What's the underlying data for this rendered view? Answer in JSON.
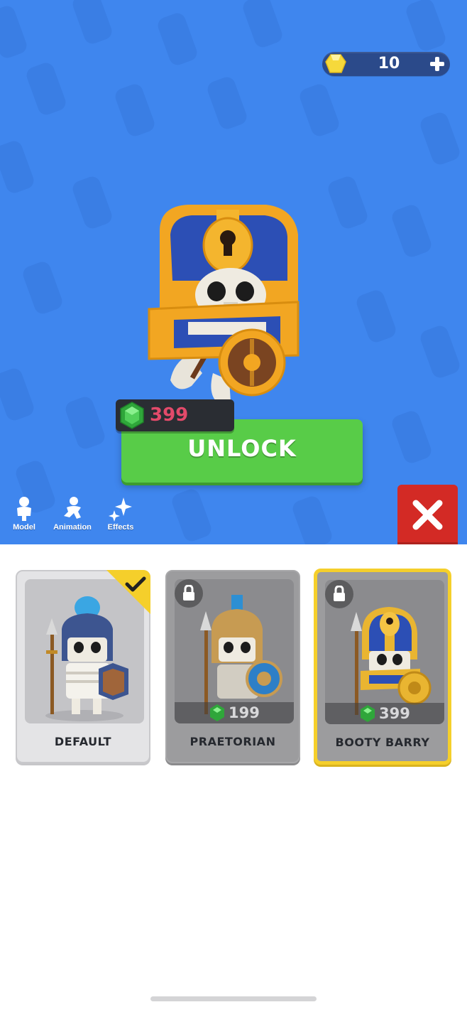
{
  "currency": {
    "amount": "10",
    "add_label": "+"
  },
  "hero": {
    "price": "399",
    "unlock_label": "UNLOCK"
  },
  "modes": [
    {
      "label": "Model"
    },
    {
      "label": "Animation"
    },
    {
      "label": "Effects"
    }
  ],
  "skins": [
    {
      "name": "DEFAULT",
      "owned": true
    },
    {
      "name": "PRAETORIAN",
      "price": "199",
      "locked": true
    },
    {
      "name": "BOOTY BARRY",
      "price": "399",
      "locked": true,
      "selected": true
    }
  ],
  "colors": {
    "background": "#3f86ee",
    "unlock_button": "#58cc48",
    "close_button": "#d32a25",
    "selected_border": "#f5cf2b",
    "price_text": "#e34a6a"
  },
  "icons": [
    "gold-gem-icon",
    "plus-icon",
    "green-gem-icon",
    "model-icon",
    "animation-icon",
    "effects-icon",
    "close-icon",
    "lock-icon",
    "checkmark-icon"
  ]
}
